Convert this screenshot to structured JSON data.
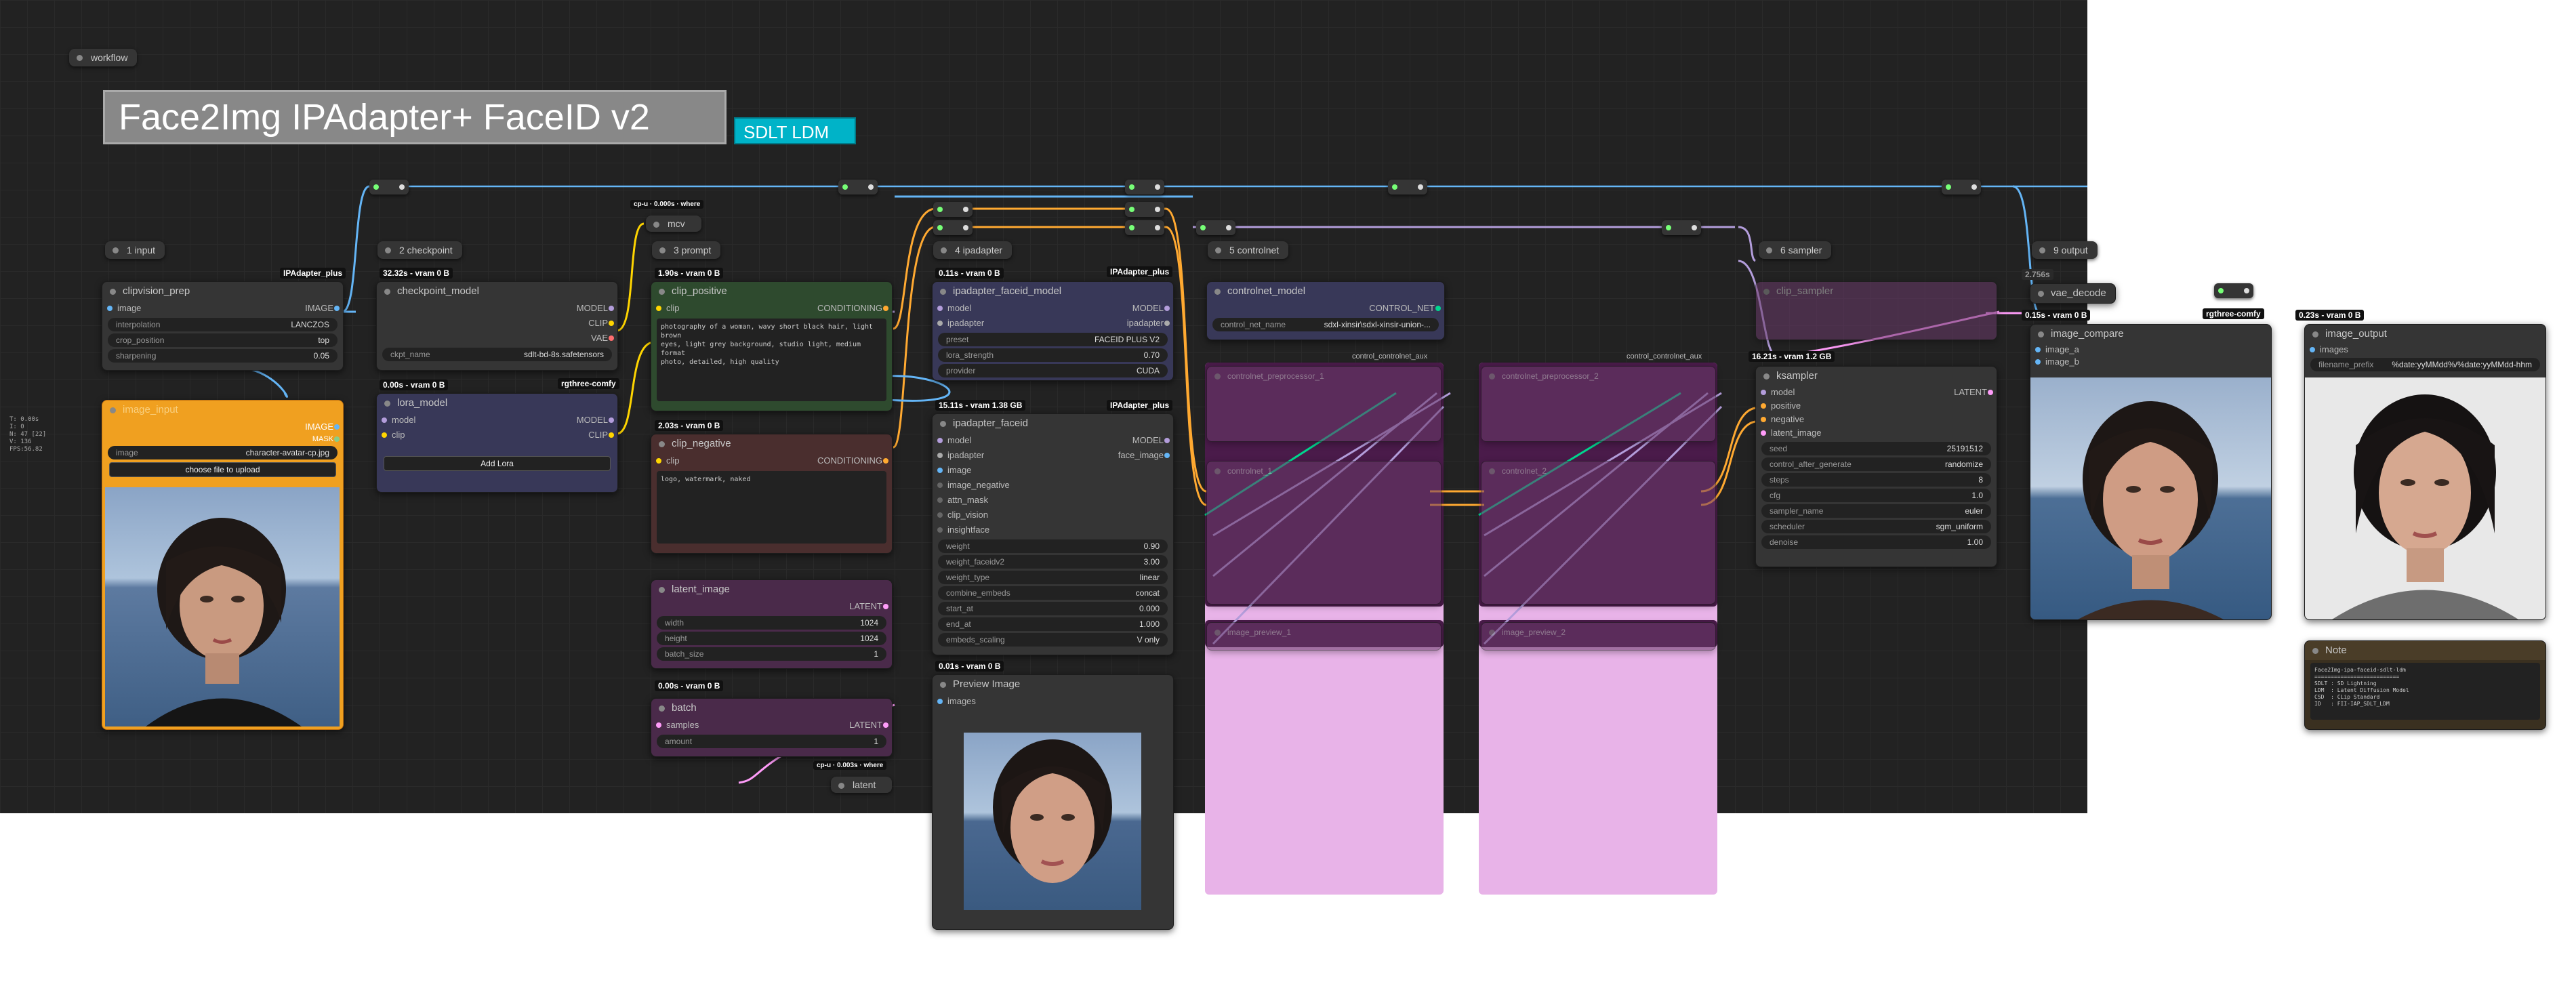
{
  "colors": {
    "graph_bg": "#222222",
    "node_bg": "#353535",
    "accent_cyan": "#00b3c8",
    "group_pink": "#e8b3e8",
    "group_purple": "#4a1b4a",
    "image_wire": "#64b5f6",
    "model_wire": "#b39ddb",
    "clip_wire": "#ffd500",
    "cond_wire": "#ffa931",
    "latent_wire": "#ff9cf9",
    "controlnet_wire": "#00d68f"
  },
  "title": {
    "main": "Face2Img IPAdapter+ FaceID v2",
    "badge": "SDLT LDM"
  },
  "group_tags": {
    "workflow": "workflow",
    "input": "1 input",
    "checkpoint": "2 checkpoint",
    "prompt": "3 prompt",
    "ipadapter": "4 ipadapter",
    "controlnet": "5 controlnet",
    "sampler": "6 sampler",
    "output": "9 output"
  },
  "badges": {
    "ipadapter_plus_1": "IPAdapter_plus",
    "ipadapter_plus_2": "IPAdapter_plus",
    "ipadapter_plus_3": "IPAdapter_plus",
    "rgthree_1": "rgthree-comfy",
    "rgthree_2": "rgthree-comfy"
  },
  "timings": {
    "checkpoint": "32.32s - vram 0 B",
    "lora": "0.00s - vram 0 B",
    "clip_pos": "1.90s - vram 0 B",
    "clip_neg": "2.03s - vram 0 B",
    "batch": "0.00s - vram 0 B",
    "ipadapter_model": "0.11s - vram 0 B",
    "faceid": "15.11s - vram 1.38 GB",
    "preview": "0.01s - vram 0 B",
    "ksampler": "16.21s - vram 1.2 GB",
    "vae": "0.15s - vram 0 B",
    "output": "0.23s - vram 0 B",
    "vae_top": "2.756s"
  },
  "reroute_labels": {
    "mcv": "mcv",
    "latent": "latent",
    "cp_where_1": "cp-u · 0.000s · where",
    "cp_where_2": "cp-u · 0.003s · where"
  },
  "stats_overlay": "T: 0.00s\nI: 0\nN: 47 [22]\nV: 136\nFPS:56.82",
  "nodes": {
    "clipvision_prep": {
      "title": "clipvision_prep",
      "slot_in": "image",
      "slot_out": "IMAGE",
      "w1": "interpolation",
      "v1": "LANCZOS",
      "w2": "crop_position",
      "v2": "top",
      "w3": "sharpening",
      "v3": "0.05"
    },
    "image_input": {
      "title": "image_input",
      "slot_out": "IMAGE",
      "slot_out2": "MASK",
      "w1": "image",
      "v1": "character-avatar-cp.jpg",
      "button": "choose file to upload"
    },
    "checkpoint_model": {
      "title": "checkpoint_model",
      "o1": "MODEL",
      "o2": "CLIP",
      "o3": "VAE",
      "w1": "ckpt_name",
      "v1": "sdlt-bd-8s.safetensors"
    },
    "lora_model": {
      "title": "lora_model",
      "i1": "model",
      "i2": "clip",
      "o1": "MODEL",
      "o2": "CLIP",
      "button": "Add Lora"
    },
    "clip_positive": {
      "title": "clip_positive",
      "i1": "clip",
      "o1": "CONDITIONING",
      "text": "photography of a woman, wavy short black hair, light brown\neyes, light grey background, studio light, medium format\nphoto, detailed, high quality"
    },
    "clip_negative": {
      "title": "clip_negative",
      "i1": "clip",
      "o1": "CONDITIONING",
      "text": "logo, watermark, naked"
    },
    "latent_image": {
      "title": "latent_image",
      "o1": "LATENT",
      "w1": "width",
      "v1": "1024",
      "w2": "height",
      "v2": "1024",
      "w3": "batch_size",
      "v3": "1"
    },
    "batch": {
      "title": "batch",
      "i1": "samples",
      "o1": "LATENT",
      "w1": "amount",
      "v1": "1"
    },
    "ipadapter_faceid_model": {
      "title": "ipadapter_faceid_model",
      "i1": "model",
      "i2": "ipadapter",
      "o1": "MODEL",
      "o2": "ipadapter",
      "w1": "preset",
      "v1": "FACEID PLUS V2",
      "w2": "lora_strength",
      "v2": "0.70",
      "w3": "provider",
      "v3": "CUDA"
    },
    "ipadapter_faceid": {
      "title": "ipadapter_faceid",
      "i1": "model",
      "i2": "ipadapter",
      "i3": "image",
      "i4": "image_negative",
      "i5": "attn_mask",
      "i6": "clip_vision",
      "i7": "insightface",
      "o1": "MODEL",
      "o2": "face_image",
      "widgets": [
        {
          "k": "weight",
          "v": "0.90"
        },
        {
          "k": "weight_faceidv2",
          "v": "3.00"
        },
        {
          "k": "weight_type",
          "v": "linear"
        },
        {
          "k": "combine_embeds",
          "v": "concat"
        },
        {
          "k": "start_at",
          "v": "0.000"
        },
        {
          "k": "end_at",
          "v": "1.000"
        },
        {
          "k": "embeds_scaling",
          "v": "V only"
        }
      ]
    },
    "preview_image": {
      "title": "Preview Image",
      "i1": "images"
    },
    "controlnet_model": {
      "title": "controlnet_model",
      "o1": "CONTROL_NET",
      "w1": "control_net_name",
      "v1": "sdxl-xinsir\\sdxl-xinsir-union-..."
    },
    "controlnet_ghost": {
      "l1": "controlnet_preprocessor_1",
      "l2": "controlnet_preprocessor_2",
      "l3": "controlnet_1",
      "l4": "controlnet_2",
      "l5": "image_preview_1",
      "l6": "image_preview_2",
      "cc1": "control_controlnet_aux",
      "cc2": "control_controlnet_aux",
      "positive": "positive",
      "negative": "negative"
    },
    "clip_sampler": {
      "title": "clip_sampler"
    },
    "ksampler": {
      "title": "ksampler",
      "i1": "model",
      "i2": "positive",
      "i3": "negative",
      "i4": "latent_image",
      "o1": "LATENT",
      "widgets": [
        {
          "k": "seed",
          "v": "25191512"
        },
        {
          "k": "control_after_generate",
          "v": "randomize"
        },
        {
          "k": "steps",
          "v": "8"
        },
        {
          "k": "cfg",
          "v": "1.0"
        },
        {
          "k": "sampler_name",
          "v": "euler"
        },
        {
          "k": "scheduler",
          "v": "sgm_uniform"
        },
        {
          "k": "denoise",
          "v": "1.00"
        }
      ]
    },
    "vae_decode": {
      "title": "vae_decode"
    },
    "image_compare": {
      "title": "image_compare",
      "i1": "image_a",
      "i2": "image_b"
    },
    "image_output": {
      "title": "image_output",
      "i1": "images",
      "w1": "filename_prefix",
      "v1": "%date:yyMMdd%/%date:yyMMdd-hhm"
    },
    "note": {
      "title": "Note",
      "text": "Face2Img-ipa-faceid-sdlt-ldm\n==========================\nSDLT : SD Lightning\nLDM  : Latent Diffusion Model\nCSD  : CLip Standard\nID   : FII-IAP_SDLT_LDM"
    }
  }
}
